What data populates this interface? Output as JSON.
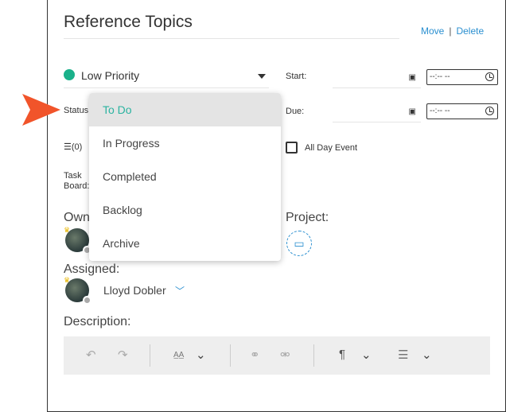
{
  "header": {
    "title": "Reference Topics",
    "move_label": "Move",
    "separator": "|",
    "delete_label": "Delete"
  },
  "priority": {
    "label": "Low Priority",
    "color": "#1ab18a"
  },
  "status": {
    "label": "Status"
  },
  "dates": {
    "start_label": "Start:",
    "due_label": "Due:",
    "time_placeholder": "--:-- --"
  },
  "comments": {
    "count": "(0)"
  },
  "all_day": {
    "label": "All Day Event"
  },
  "task_board": {
    "label_line1": "Task",
    "label_line2": "Board:"
  },
  "owner": {
    "label": "Owne"
  },
  "project": {
    "label": "Project:"
  },
  "assigned": {
    "label": "Assigned:",
    "name": "Lloyd Dobler"
  },
  "description": {
    "label": "Description:"
  },
  "status_dropdown": {
    "options": [
      "To Do",
      "In Progress",
      "Completed",
      "Backlog",
      "Archive"
    ],
    "selected": "To Do",
    "selected_color": "#2ab3a0"
  },
  "colors": {
    "link": "#2a8fd0",
    "callout_arrow": "#f1542a"
  },
  "icons": [
    "calendar-icon",
    "clock-icon",
    "comment-icon",
    "folder-icon",
    "undo-icon",
    "redo-icon",
    "font-size-icon",
    "link-icon",
    "unlink-icon",
    "paragraph-icon",
    "list-icon",
    "chevron-down-icon"
  ]
}
